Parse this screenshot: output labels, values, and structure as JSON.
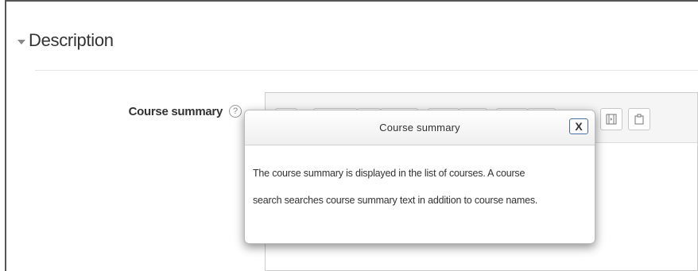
{
  "section": {
    "title": "Description"
  },
  "field": {
    "label": "Course summary",
    "help_icon": "question-mark-icon"
  },
  "editor": {
    "toolbar_icons": [
      "toolbar-button",
      "toolbar-button",
      "toolbar-button",
      "toolbar-button",
      "toolbar-button",
      "toolbar-button",
      "toolbar-button",
      "toolbar-button",
      "media-icon",
      "manage-files-icon"
    ]
  },
  "help_popup": {
    "title": "Course summary",
    "close_label": "X",
    "body_line1": "The course summary is displayed in the list of courses. A course",
    "body_line2": "search searches course summary text in addition to course names."
  },
  "colors": {
    "close_border": "#4a6ea9",
    "legend_caret": "#888888"
  }
}
